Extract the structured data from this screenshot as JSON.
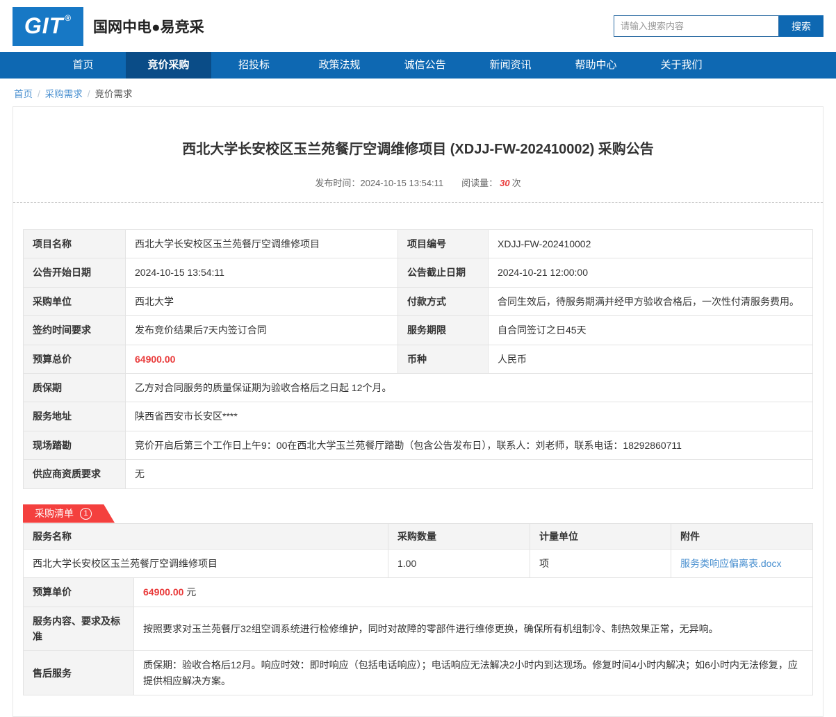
{
  "header": {
    "logo_text": "GIT",
    "logo_reg": "®",
    "brand": "国网中电●易竞采",
    "search": {
      "placeholder": "请输入搜索内容",
      "button": "搜索"
    }
  },
  "nav": {
    "items": [
      {
        "label": "首页",
        "active": false
      },
      {
        "label": "竞价采购",
        "active": true
      },
      {
        "label": "招投标",
        "active": false
      },
      {
        "label": "政策法规",
        "active": false
      },
      {
        "label": "诚信公告",
        "active": false
      },
      {
        "label": "新闻资讯",
        "active": false
      },
      {
        "label": "帮助中心",
        "active": false
      },
      {
        "label": "关于我们",
        "active": false
      }
    ]
  },
  "breadcrumb": {
    "separator": "/",
    "items": [
      "首页",
      "采购需求",
      "竞价需求"
    ]
  },
  "announcement": {
    "title": "西北大学长安校区玉兰苑餐厅空调维修项目 (XDJJ-FW-202410002) 采购公告",
    "publish_label": "发布时间：",
    "publish_time": "2024-10-15 13:54:11",
    "views_label": "阅读量：",
    "views_count": "30",
    "views_unit": "次"
  },
  "info_table": {
    "rows": [
      {
        "label1": "项目名称",
        "value1": "西北大学长安校区玉兰苑餐厅空调维修项目",
        "label2": "项目编号",
        "value2": "XDJJ-FW-202410002"
      },
      {
        "label1": "公告开始日期",
        "value1": "2024-10-15 13:54:11",
        "label2": "公告截止日期",
        "value2": "2024-10-21 12:00:00"
      },
      {
        "label1": "采购单位",
        "value1": "西北大学",
        "label2": "付款方式",
        "value2": "合同生效后，待服务期满并经甲方验收合格后，一次性付清服务费用。"
      },
      {
        "label1": "签约时间要求",
        "value1": "发布竞价结果后7天内签订合同",
        "label2": "服务期限",
        "value2": "自合同签订之日45天"
      },
      {
        "label1": "预算总价",
        "value1": "64900.00",
        "label2": "币种",
        "value2": "人民币"
      },
      {
        "label": "质保期",
        "value": "乙方对合同服务的质量保证期为验收合格后之日起 12个月。"
      },
      {
        "label": "服务地址",
        "value": "陕西省西安市长安区****"
      },
      {
        "label": "现场踏勘",
        "value": "竞价开启后第三个工作日上午9：00在西北大学玉兰苑餐厅踏勘（包含公告发布日），联系人：刘老师，联系电话：18292860711"
      },
      {
        "label": "供应商资质要求",
        "value": "无"
      }
    ]
  },
  "purchase_list": {
    "badge_label": "采购清单",
    "badge_count": "1",
    "columns": [
      "服务名称",
      "采购数量",
      "计量单位",
      "附件"
    ],
    "row": {
      "name": "西北大学长安校区玉兰苑餐厅空调维修项目",
      "quantity": "1.00",
      "unit": "项",
      "attachment": "服务类响应偏离表.docx"
    },
    "details": [
      {
        "label": "预算单价",
        "value": "64900.00",
        "suffix": "元"
      },
      {
        "label": "服务内容、要求及标准",
        "value": "按照要求对玉兰苑餐厅32组空调系统进行检修维护，同时对故障的零部件进行维修更换，确保所有机组制冷、制热效果正常，无异响。"
      },
      {
        "label": "售后服务",
        "value": "质保期：验收合格后12月。响应时效：即时响应（包括电话响应）；电话响应无法解决2小时内到达现场。修复时间4小时内解决；如6小时内无法修复，应提供相应解决方案。"
      }
    ]
  },
  "colors": {
    "nav_blue": "#0e68b2",
    "nav_active_blue": "#0a4c87",
    "logo_blue": "#1778c5",
    "badge_red": "#f4403e",
    "highlight_red": "#e93a3a",
    "link_blue": "#4a90d0",
    "label_cell_bg": "#f4f4f4"
  }
}
